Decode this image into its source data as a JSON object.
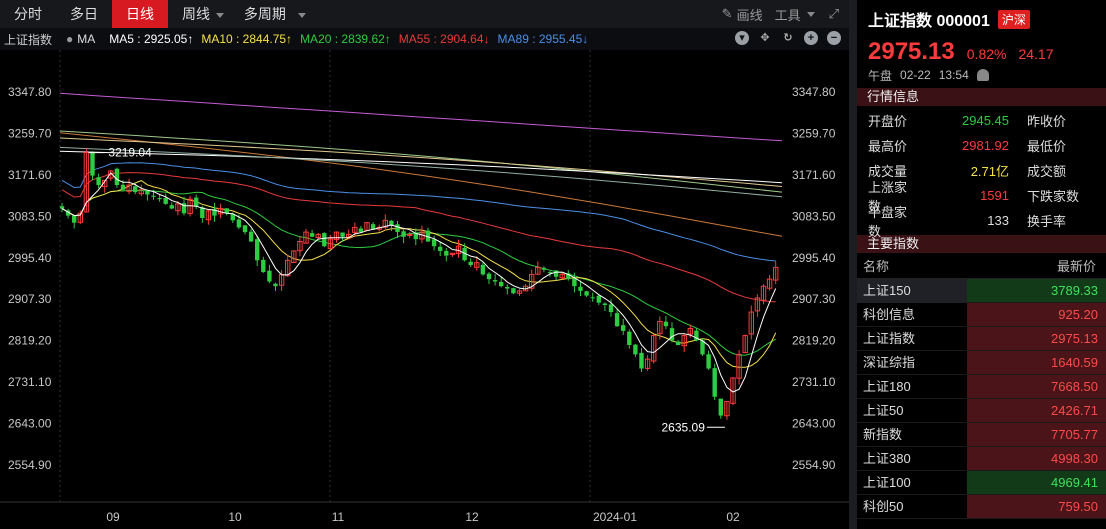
{
  "toolbar": {
    "tabs": [
      {
        "label": "分时",
        "active": false
      },
      {
        "label": "多日",
        "active": false
      },
      {
        "label": "日线",
        "active": true
      },
      {
        "label": "周线",
        "active": false
      },
      {
        "label": "多周期",
        "active": false
      }
    ],
    "draw_label": "画线",
    "tools_label": "工具"
  },
  "ma_bar": {
    "index_name": "上证指数",
    "ma_label": "MA",
    "ma5": "MA5 : 2925.05↑",
    "ma10": "MA10 : 2844.75↑",
    "ma20": "MA20 : 2839.62↑",
    "ma55": "MA55 : 2904.64↓",
    "ma89": "MA89 : 2955.45↓",
    "colors": {
      "ma5": "#ffffff",
      "ma10": "#f5e04a",
      "ma20": "#2ecc40",
      "ma55": "#e83a3a",
      "ma89": "#4a8fe8"
    }
  },
  "chart_data": {
    "type": "candlestick",
    "y_ticks": [
      "3347.80",
      "3259.70",
      "3171.60",
      "3083.50",
      "2995.40",
      "2907.30",
      "2819.20",
      "2731.10",
      "2643.00",
      "2554.90"
    ],
    "ylim": [
      2554.9,
      3347.8
    ],
    "x_ticks": [
      "09",
      "10",
      "11",
      "12",
      "2024-01",
      "02"
    ],
    "annotations": [
      {
        "label": "3219.04",
        "value": 3219.04
      },
      {
        "label": "2635.09",
        "value": 2635.09
      }
    ],
    "colors": {
      "up": "#ff3b3b",
      "down": "#2ecc40",
      "ma89": "#4a8fe8",
      "ma55": "#e83a3a",
      "ma20": "#2ecc40",
      "ma10": "#f5e04a",
      "ma5": "#ffffff",
      "long1": "#c85ad8",
      "long2": "#c8783a",
      "long3": "#9ec88a",
      "long4": "#e0c890",
      "long5": "#ffffff"
    }
  },
  "header": {
    "title": "上证指数 000001",
    "badge": "沪深",
    "price": "2975.13",
    "change_pct": "0.82%",
    "change": "24.17",
    "session": "午盘",
    "date": "02-22",
    "time": "13:54"
  },
  "quote_section_title": "行情信息",
  "quote": [
    {
      "k1": "开盘价",
      "v1": "2945.45",
      "c1": "#2ecc40",
      "k2": "昨收价"
    },
    {
      "k1": "最高价",
      "v1": "2981.92",
      "c1": "#ff3b3b",
      "k2": "最低价"
    },
    {
      "k1": "成交量",
      "v1": "2.71亿",
      "c1": "#f5e04a",
      "k2": "成交额"
    },
    {
      "k1": "上涨家数",
      "v1": "1591",
      "c1": "#ff3b3b",
      "k2": "下跌家数"
    },
    {
      "k1": "平盘家数",
      "v1": "133",
      "c1": "#dddddd",
      "k2": "换手率"
    }
  ],
  "index_section_title": "主要指数",
  "index_list_header": {
    "name": "名称",
    "latest": "最新价"
  },
  "index_list": [
    {
      "name": "上证150",
      "value": "3789.33",
      "up": false,
      "selected": true
    },
    {
      "name": "科创信息",
      "value": "925.20",
      "up": true,
      "selected": false
    },
    {
      "name": "上证指数",
      "value": "2975.13",
      "up": true,
      "selected": false
    },
    {
      "name": "深证综指",
      "value": "1640.59",
      "up": true,
      "selected": false
    },
    {
      "name": "上证180",
      "value": "7668.50",
      "up": true,
      "selected": false
    },
    {
      "name": "上证50",
      "value": "2426.71",
      "up": true,
      "selected": false
    },
    {
      "name": "新指数",
      "value": "7705.77",
      "up": true,
      "selected": false
    },
    {
      "name": "上证380",
      "value": "4998.30",
      "up": true,
      "selected": false
    },
    {
      "name": "上证100",
      "value": "4969.41",
      "up": false,
      "selected": false
    },
    {
      "name": "科创50",
      "value": "759.50",
      "up": true,
      "selected": false
    }
  ]
}
